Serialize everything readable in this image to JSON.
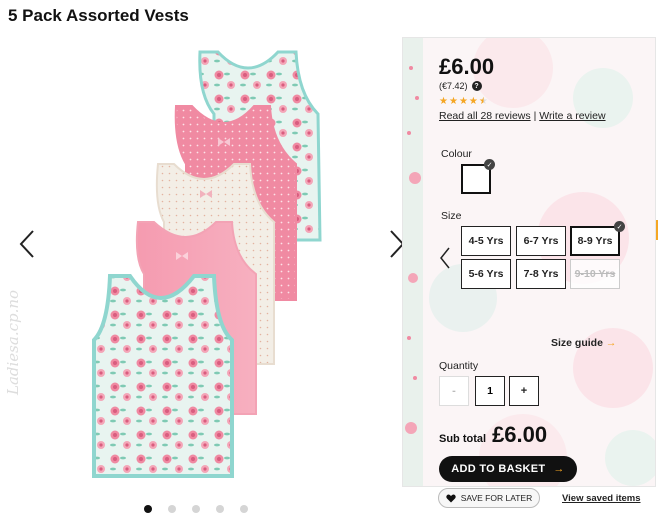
{
  "product": {
    "title": "5 Pack Assorted Vests"
  },
  "gallery": {
    "prev_icon": "chevron-left-icon",
    "next_icon": "chevron-right-icon",
    "dot_count": 5,
    "active_dot": 0
  },
  "watermark": "Ladiesa.cp.no",
  "pricing": {
    "price": "£6.00",
    "price_eur": "(€7.42)",
    "rating": 4.5,
    "rating_max": 5,
    "read_reviews": "Read all 28 reviews",
    "separator": "|",
    "write_review": "Write a review"
  },
  "colour": {
    "label": "Colour",
    "selected": "#ffffff"
  },
  "size": {
    "label": "Size",
    "options": [
      {
        "label": "4-5 Yrs",
        "state": "available"
      },
      {
        "label": "6-7 Yrs",
        "state": "available"
      },
      {
        "label": "8-9 Yrs",
        "state": "selected"
      },
      {
        "label": "5-6 Yrs",
        "state": "available"
      },
      {
        "label": "7-8 Yrs",
        "state": "available"
      },
      {
        "label": "9-10 Yrs",
        "state": "unavailable"
      }
    ],
    "guide_label": "Size guide",
    "guide_arrow": "→"
  },
  "quantity": {
    "label": "Quantity",
    "minus": "-",
    "value": "1",
    "plus": "+"
  },
  "subtotal": {
    "label": "Sub total",
    "value": "£6.00"
  },
  "actions": {
    "add_to_basket": "ADD TO BASKET",
    "basket_arrow": "→",
    "save_for_later": "SAVE FOR LATER",
    "view_saved": "View saved items"
  },
  "colors": {
    "accent": "#f5a623",
    "dark": "#111111",
    "vest_pink": "#f08aa2",
    "vest_mint": "#8fd6cf",
    "vest_cream": "#f3eee6"
  }
}
